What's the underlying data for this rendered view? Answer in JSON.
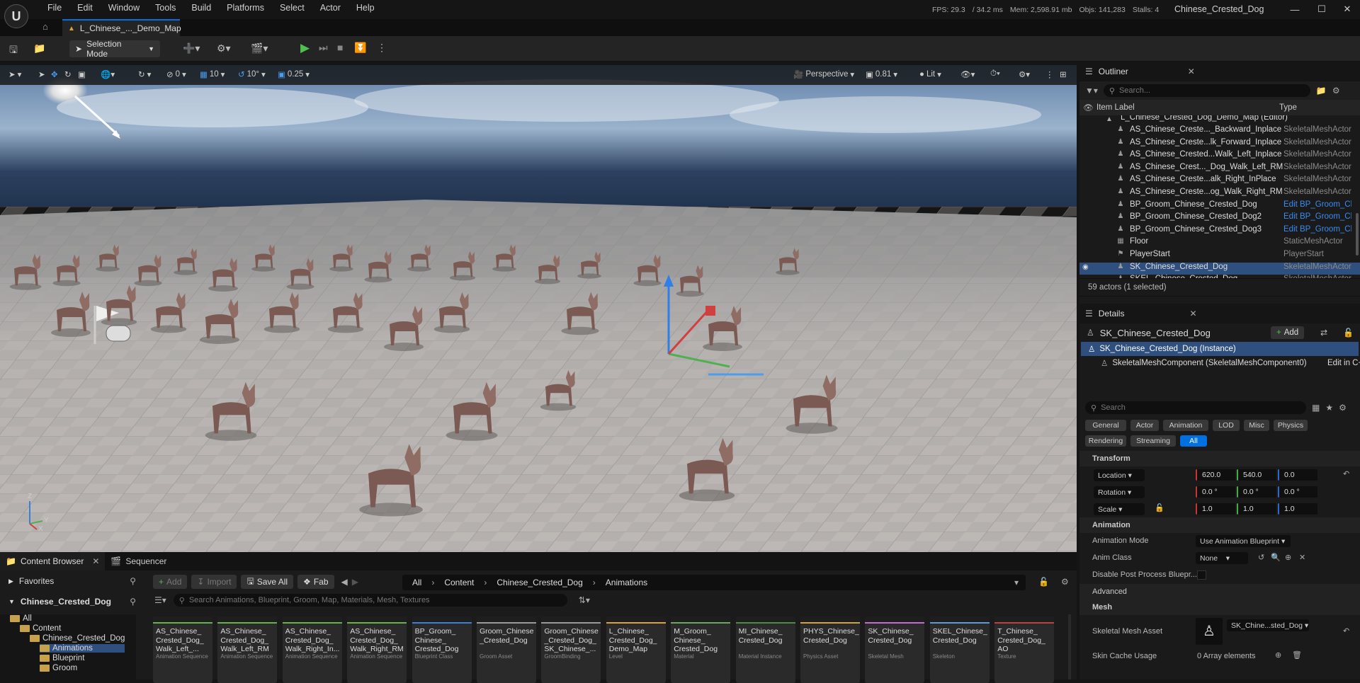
{
  "menu": [
    "File",
    "Edit",
    "Window",
    "Tools",
    "Build",
    "Platforms",
    "Select",
    "Actor",
    "Help"
  ],
  "stats": {
    "fps": "FPS: 29.3",
    "ms": "/ 34.2 ms",
    "mem": "Mem: 2,598.91 mb",
    "objs": "Objs: 141,283",
    "stalls": "Stalls: 4"
  },
  "project_name": "Chinese_Crested_Dog",
  "map_tab": "L_Chinese_..._Demo_Map",
  "toolbar": {
    "selection_mode": "Selection Mode"
  },
  "viewport": {
    "perspective": "Perspective",
    "fov": "0.81",
    "lit": "Lit",
    "snap_grid": "10",
    "snap_rot": "10°",
    "snap_scale": "0.25",
    "zero": "0"
  },
  "outliner": {
    "tab": "Outliner",
    "search_placeholder": "Search...",
    "col_label": "Item Label",
    "col_type": "Type",
    "root": "L_Chinese_Crested_Dog_Demo_Map (Editor)",
    "rows": [
      {
        "label": "AS_Chinese_Creste..._Backward_Inplace",
        "type": "SkeletalMeshActor",
        "link": false,
        "icon": "person-icon",
        "selected": false
      },
      {
        "label": "AS_Chinese_Creste...lk_Forward_Inplace",
        "type": "SkeletalMeshActor",
        "link": false,
        "icon": "person-icon",
        "selected": false
      },
      {
        "label": "AS_Chinese_Crested...Walk_Left_Inplace",
        "type": "SkeletalMeshActor",
        "link": false,
        "icon": "person-icon",
        "selected": false
      },
      {
        "label": "AS_Chinese_Crest..._Dog_Walk_Left_RM",
        "type": "SkeletalMeshActor",
        "link": false,
        "icon": "person-icon",
        "selected": false
      },
      {
        "label": "AS_Chinese_Creste...alk_Right_InPlace",
        "type": "SkeletalMeshActor",
        "link": false,
        "icon": "person-icon",
        "selected": false
      },
      {
        "label": "AS_Chinese_Creste...og_Walk_Right_RM",
        "type": "SkeletalMeshActor",
        "link": false,
        "icon": "person-icon",
        "selected": false
      },
      {
        "label": "BP_Groom_Chinese_Crested_Dog",
        "type": "Edit BP_Groom_Chi",
        "link": true,
        "icon": "person-icon",
        "selected": false
      },
      {
        "label": "BP_Groom_Chinese_Crested_Dog2",
        "type": "Edit BP_Groom_Chi",
        "link": true,
        "icon": "person-icon",
        "selected": false
      },
      {
        "label": "BP_Groom_Chinese_Crested_Dog3",
        "type": "Edit BP_Groom_Chi",
        "link": true,
        "icon": "person-icon",
        "selected": false
      },
      {
        "label": "Floor",
        "type": "StaticMeshActor",
        "link": false,
        "icon": "cube-icon",
        "selected": false
      },
      {
        "label": "PlayerStart",
        "type": "PlayerStart",
        "link": false,
        "icon": "flag-icon",
        "selected": false
      },
      {
        "label": "SK_Chinese_Crested_Dog",
        "type": "SkeletalMeshActor",
        "link": false,
        "icon": "person-icon",
        "selected": true
      },
      {
        "label": "SKEL_Chinese_Crested_Dog",
        "type": "SkeletalMeshActor",
        "link": false,
        "icon": "person-icon",
        "selected": false
      }
    ],
    "count": "59 actors (1 selected)"
  },
  "details": {
    "tab": "Details",
    "actor": "SK_Chinese_Crested_Dog",
    "add": "Add",
    "instance": "SK_Chinese_Crested_Dog (Instance)",
    "component": "SkeletalMeshComponent (SkeletalMeshComponent0)",
    "edit_link": "Edit in C++",
    "search_placeholder": "Search",
    "filters": [
      "General",
      "Actor",
      "Animation",
      "LOD",
      "Misc",
      "Physics"
    ],
    "filters2": [
      "Rendering",
      "Streaming",
      "All"
    ],
    "transform": "Transform",
    "location": "Location",
    "rotation": "Rotation",
    "scale": "Scale",
    "loc": [
      "620.0",
      "540.0",
      "0.0"
    ],
    "rot": [
      "0.0 °",
      "0.0 °",
      "0.0 °"
    ],
    "scl": [
      "1.0",
      "1.0",
      "1.0"
    ],
    "animation": "Animation",
    "anim_mode": "Animation Mode",
    "anim_mode_val": "Use Animation Blueprint",
    "anim_class": "Anim Class",
    "anim_class_val": "None",
    "disable_pp": "Disable Post Process Bluepr...",
    "advanced": "Advanced",
    "mesh": "Mesh",
    "skel_asset": "Skeletal Mesh Asset",
    "skel_asset_val": "SK_Chine...sted_Dog",
    "skin_cache": "Skin Cache Usage",
    "skin_cache_val": "0 Array elements"
  },
  "content_browser": {
    "tab": "Content Browser",
    "seq_tab": "Sequencer",
    "favorites": "Favorites",
    "project": "Chinese_Crested_Dog",
    "add": "Add",
    "import": "Import",
    "save_all": "Save All",
    "fab": "Fab",
    "breadcrumb": [
      "All",
      "Content",
      "Chinese_Crested_Dog",
      "Animations"
    ],
    "search_placeholder": "Search Animations, Blueprint, Groom, Map, Materials, Mesh, Textures",
    "tree": [
      "All",
      "Content",
      "Chinese_Crested_Dog",
      "Animations",
      "Blueprint",
      "Groom"
    ],
    "assets": [
      {
        "name": "AS_Chinese_\nCrested_Dog_\nWalk_Left_...",
        "type": "Animation Sequence",
        "color": "#63b34a"
      },
      {
        "name": "AS_Chinese_\nCrested_Dog_\nWalk_Left_RM",
        "type": "Animation Sequence",
        "color": "#63b34a"
      },
      {
        "name": "AS_Chinese_\nCrested_Dog_\nWalk_Right_In...",
        "type": "Animation Sequence",
        "color": "#63b34a"
      },
      {
        "name": "AS_Chinese_\nCrested_Dog_\nWalk_Right_RM",
        "type": "Animation Sequence",
        "color": "#63b34a"
      },
      {
        "name": "BP_Groom_\nChinese_\nCrested_Dog",
        "type": "Blueprint Class",
        "color": "#3b7fd6"
      },
      {
        "name": "Groom_Chinese\n_Crested_Dog",
        "type": "Groom Asset",
        "color": "#999999"
      },
      {
        "name": "Groom_Chinese\n_Crested_Dog_\nSK_Chinese_...",
        "type": "GroomBinding",
        "color": "#999999"
      },
      {
        "name": "L_Chinese_\nCrested_Dog_\nDemo_Map",
        "type": "Level",
        "color": "#d9a23a"
      },
      {
        "name": "M_Groom_\nChinese_\nCrested_Dog",
        "type": "Material",
        "color": "#6aa85a"
      },
      {
        "name": "MI_Chinese_\nCrested_Dog",
        "type": "Material Instance",
        "color": "#4c8c3c"
      },
      {
        "name": "PHYS_Chinese_\nCrested_Dog",
        "type": "Physics Asset",
        "color": "#d6a23a"
      },
      {
        "name": "SK_Chinese_\nCrested_Dog",
        "type": "Skeletal Mesh",
        "color": "#c46ad0"
      },
      {
        "name": "SKEL_Chinese_\nCrested_Dog",
        "type": "Skeleton",
        "color": "#5a9ad6"
      },
      {
        "name": "T_Chinese_\nCrested_Dog_\nAO",
        "type": "Texture",
        "color": "#c04040"
      }
    ]
  }
}
